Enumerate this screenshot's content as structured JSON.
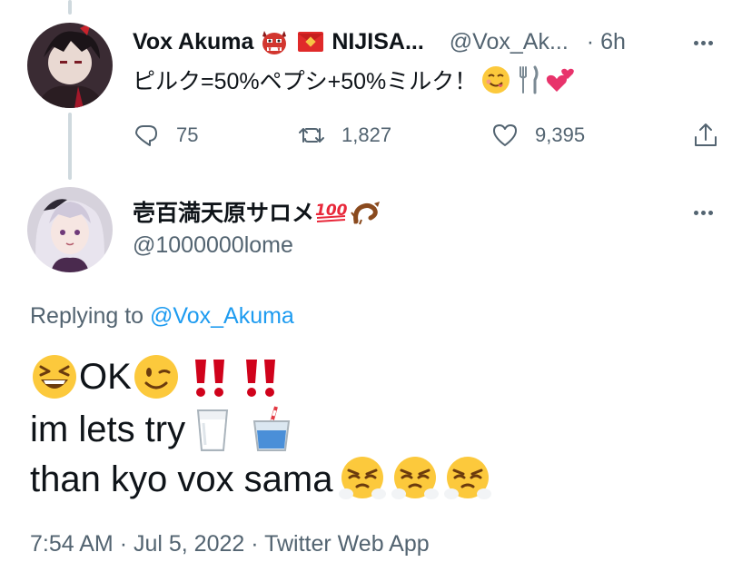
{
  "tweet_1": {
    "display_name": "Vox Akuma",
    "name_suffix": "NIJISA...",
    "handle": "@Vox_Ak...",
    "time": "· 6h",
    "text": "ピルク=50%ペプシ+50%ミルク！",
    "emojis": [
      "savoring-face-emoji",
      "fork-knife-emoji",
      "two-hearts-emoji"
    ],
    "actions": {
      "replies": "75",
      "retweets": "1,827",
      "likes": "9,395"
    },
    "avatar_icon": "vox-akuma-avatar"
  },
  "tweet_2": {
    "display_name": "壱百満天原サロメ",
    "name_emojis": [
      "hundred-points-emoji",
      "scorpion-emoji"
    ],
    "handle": "@1000000lome",
    "replying_prefix": "Replying to",
    "replying_handle": "@Vox_Akuma",
    "text_lines": [
      "OK",
      "im lets try",
      "than kyo vox sama"
    ],
    "meta": {
      "time": "7:54 AM",
      "separator_1": "·",
      "date": "Jul 5, 2022",
      "separator_2": "·",
      "source": "Twitter Web App"
    },
    "avatar_icon": "salome-avatar"
  },
  "colors": {
    "text": "#0f1419",
    "secondary": "#536471",
    "link": "#1d9bf0",
    "thread_line": "#cfd9de",
    "double_exclamation": "#d0021b"
  }
}
